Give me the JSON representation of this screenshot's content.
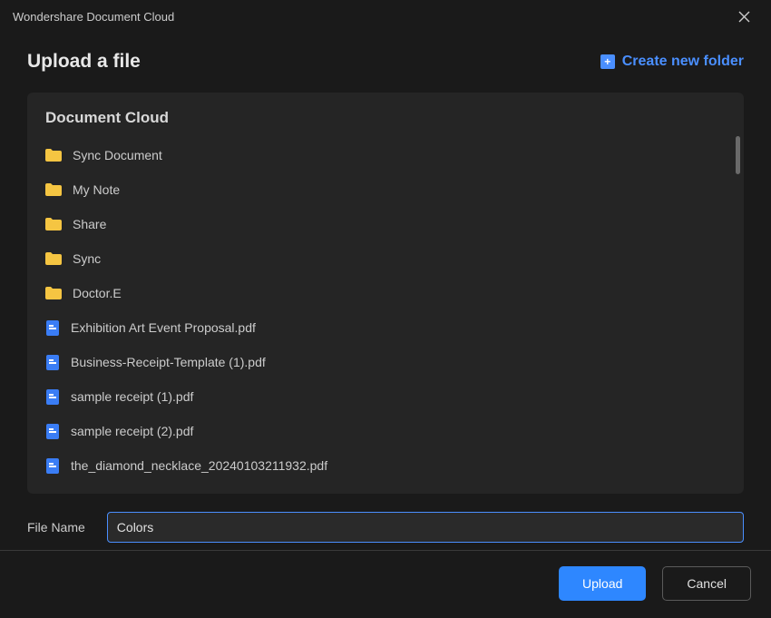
{
  "window": {
    "title": "Wondershare Document Cloud"
  },
  "header": {
    "title": "Upload a file",
    "create_folder_label": "Create new folder"
  },
  "panel": {
    "title": "Document Cloud",
    "items": [
      {
        "type": "folder",
        "name": "Sync Document"
      },
      {
        "type": "folder",
        "name": "My Note"
      },
      {
        "type": "folder",
        "name": "Share"
      },
      {
        "type": "folder",
        "name": "Sync"
      },
      {
        "type": "folder",
        "name": "Doctor.E"
      },
      {
        "type": "file",
        "name": "Exhibition Art Event Proposal.pdf"
      },
      {
        "type": "file",
        "name": "Business-Receipt-Template (1).pdf"
      },
      {
        "type": "file",
        "name": "sample receipt (1).pdf"
      },
      {
        "type": "file",
        "name": "sample receipt (2).pdf"
      },
      {
        "type": "file",
        "name": "the_diamond_necklace_20240103211932.pdf"
      }
    ]
  },
  "filename": {
    "label": "File Name",
    "value": "Colors"
  },
  "footer": {
    "upload_label": "Upload",
    "cancel_label": "Cancel"
  },
  "colors": {
    "accent": "#2e87ff",
    "link": "#4a8fff",
    "folder": "#f5c542",
    "panel_bg": "#252525"
  }
}
